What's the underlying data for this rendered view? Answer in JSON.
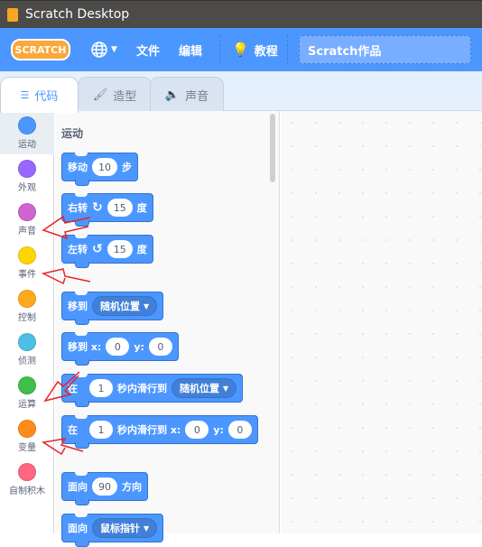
{
  "window": {
    "title": "Scratch Desktop"
  },
  "menu": {
    "logo": "SCRATCH",
    "language_icon": "globe-icon",
    "file": "文件",
    "edit": "编辑",
    "tutorials": "教程",
    "project_title": "Scratch作品"
  },
  "tabs": [
    {
      "label": "代码",
      "active": true
    },
    {
      "label": "造型"
    },
    {
      "label": "声音"
    }
  ],
  "categories": [
    {
      "label": "运动",
      "color": "#4c97ff"
    },
    {
      "label": "外观",
      "color": "#9966ff"
    },
    {
      "label": "声音",
      "color": "#cf63cf"
    },
    {
      "label": "事件",
      "color": "#ffd500"
    },
    {
      "label": "控制",
      "color": "#ffab19"
    },
    {
      "label": "侦测",
      "color": "#4cbfe6"
    },
    {
      "label": "运算",
      "color": "#40bf4a"
    },
    {
      "label": "变量",
      "color": "#ff8c1a"
    },
    {
      "label": "自制积木",
      "color": "#ff6680"
    }
  ],
  "palette": {
    "title": "运动",
    "blocks": {
      "move": {
        "a": "移动",
        "v": "10",
        "b": "步"
      },
      "turn_right": {
        "a": "右转",
        "v": "15",
        "b": "度"
      },
      "turn_left": {
        "a": "左转",
        "v": "15",
        "b": "度"
      },
      "goto": {
        "a": "移到",
        "dd": "随机位置"
      },
      "goto_xy": {
        "a": "移到 x:",
        "x": "0",
        "y_label": "y:",
        "y": "0"
      },
      "glide": {
        "a": "在",
        "v": "1",
        "b": "秒内滑行到",
        "dd": "随机位置"
      },
      "glide_xy": {
        "a": "在",
        "v": "1",
        "b": "秒内滑行到 x:",
        "x": "0",
        "y_label": "y:",
        "y": "0"
      },
      "point": {
        "a": "面向",
        "v": "90",
        "b": "方向"
      },
      "point_towards": {
        "a": "面向",
        "dd": "鼠标指针"
      }
    }
  },
  "annotation_color": "#e8222a"
}
